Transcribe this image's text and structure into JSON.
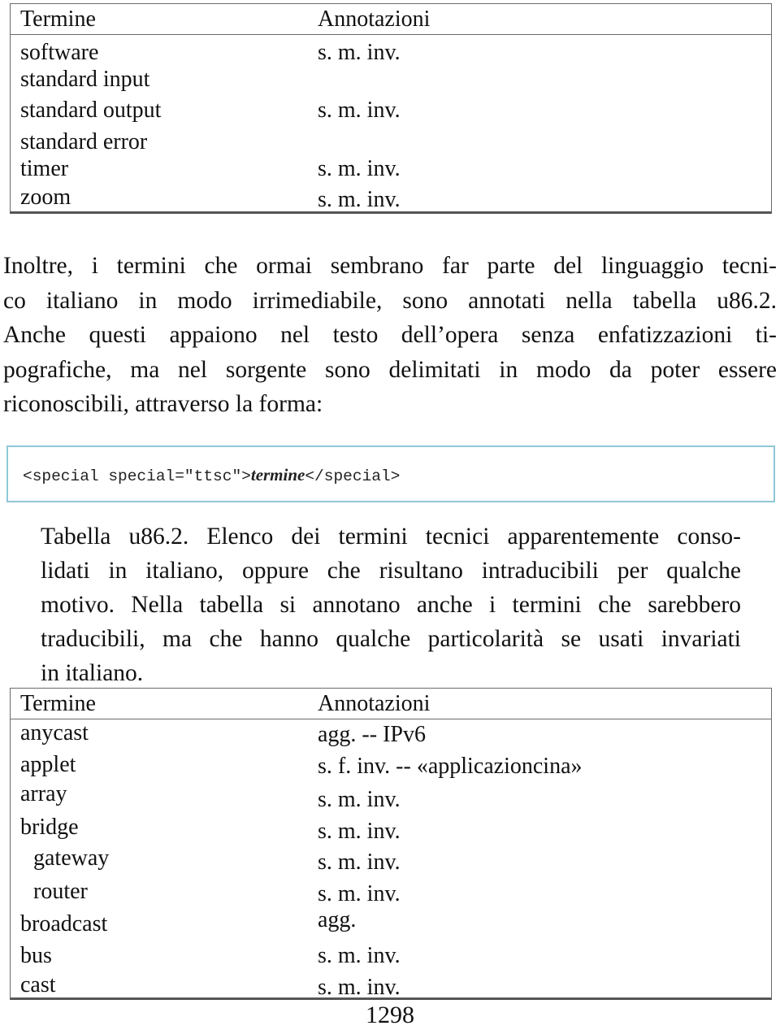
{
  "table1": {
    "headers": {
      "term": "Termine",
      "annotations": "Annotazioni"
    },
    "rows": [
      {
        "term": "software",
        "annotation": "s. m. inv."
      },
      {
        "term": "standard input",
        "annotation": ""
      },
      {
        "term": "standard output",
        "annotation": "s. m. inv."
      },
      {
        "term": "standard error",
        "annotation": ""
      },
      {
        "term": "timer",
        "annotation": "s. m. inv."
      },
      {
        "term": "zoom",
        "annotation": "s. m. inv."
      }
    ]
  },
  "paragraph": {
    "lines": [
      "Inoltre, i termini che ormai sembrano far parte del linguaggio tecni-",
      "co italiano in modo irrimediabile, sono annotati nella tabella u86.2.",
      "Anche questi appaiono nel testo dell’opera senza enfatizzazioni ti-",
      "pografiche, ma nel sorgente sono delimitati in modo da poter essere",
      "riconoscibili, attraverso la forma:"
    ]
  },
  "code": {
    "prefix": "<special special=\"ttsc\">",
    "emphasis": "termine",
    "suffix": "</special>"
  },
  "caption": {
    "lines": [
      "Tabella u86.2. Elenco dei termini tecnici apparentemente conso-",
      "lidati in italiano, oppure che risultano intraducibili per qualche",
      "motivo.  Nella tabella si annotano anche i termini che sarebbero",
      "traducibili, ma che hanno qualche particolarità se usati invariati",
      "in italiano."
    ]
  },
  "table2": {
    "headers": {
      "term": "Termine",
      "annotations": "Annotazioni"
    },
    "rows": [
      {
        "term": "anycast",
        "annotation": "agg. -- IPv6"
      },
      {
        "term": "applet",
        "annotation": "s. f. inv. -- «applicazioncina»"
      },
      {
        "term": "array",
        "annotation": "s. m. inv."
      },
      {
        "term": "bridge",
        "annotation": "s. m. inv."
      },
      {
        "term": "gateway",
        "annotation": "s. m. inv."
      },
      {
        "term": "router",
        "annotation": "s. m. inv."
      },
      {
        "term": "broadcast",
        "annotation": "agg."
      },
      {
        "term": "bus",
        "annotation": "s. m. inv."
      },
      {
        "term": "cast",
        "annotation": "s. m. inv."
      }
    ]
  },
  "page_number": "1298"
}
